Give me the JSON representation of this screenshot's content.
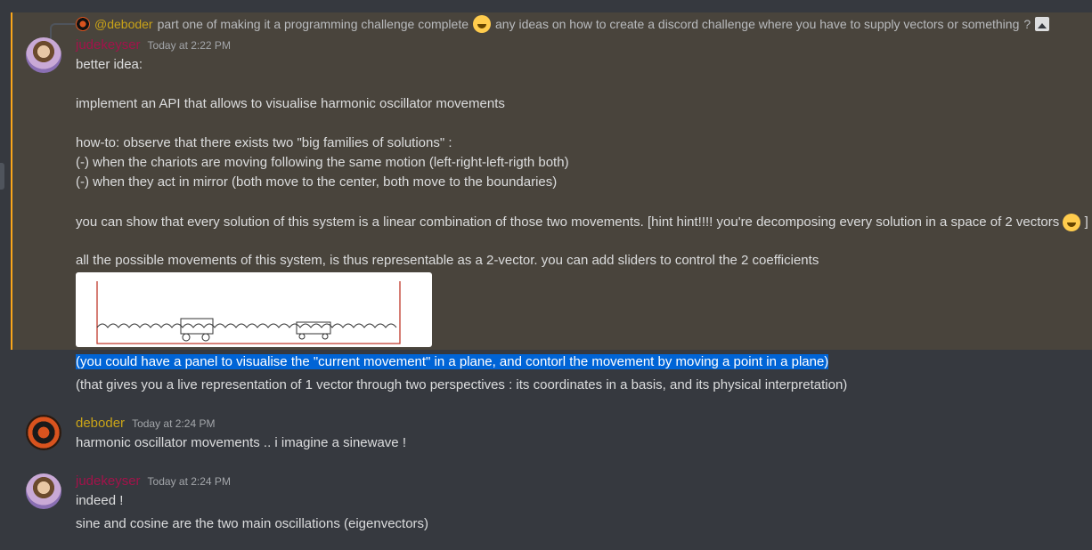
{
  "reply": {
    "username": "@deboder",
    "text_before": "part one of making it a programming challenge complete",
    "text_after": "any ideas on how to create a discord challenge where you have to supply vectors or something",
    "trailing": "?"
  },
  "messages": [
    {
      "username": "judekeyser",
      "timestamp": "Today at 2:22 PM",
      "lines": [
        "better idea:",
        "implement an API that allows to visualise harmonic oscillator movements",
        "how-to: observe that there exists two \"big families of solutions\" :",
        "(-) when the chariots are moving following the same motion (left-right-left-rigth both)",
        "(-) when they act in mirror (both move to the center, both move to the boundaries)",
        "you can show that every solution of this system is a linear combination of those two movements. [hint hint!!!! you're decomposing every solution in a space of 2 vectors",
        "all the possible movements of this system, is thus representable as a 2-vector. you can add sliders to control the 2 coefficients"
      ],
      "bracket_close": "]",
      "followups": [
        "(you could have a panel to visualise the \"current movement\" in a plane, and contorl the movement by moving a point in a plane)",
        "(that gives you a live representation of 1 vector through two perspectives : its coordinates in a basis, and its physical interpretation)"
      ]
    },
    {
      "username": "deboder",
      "timestamp": "Today at 2:24 PM",
      "lines": [
        "harmonic oscillator movements .. i imagine a sinewave !"
      ]
    },
    {
      "username": "judekeyser",
      "timestamp": "Today at 2:24 PM",
      "lines": [
        "indeed !",
        "sine and cosine are the two main oscillations (eigenvectors)"
      ]
    }
  ],
  "colors": {
    "background": "#36393f",
    "mention_highlight": "#49443c",
    "mention_bar": "#faa61a",
    "selection": "#0064d6",
    "username_red": "#a3124a",
    "username_gold": "#c9a318"
  },
  "icons": {
    "smile": "grinning-face-icon",
    "wink": "winking-face-icon",
    "image": "image-attachment-icon"
  }
}
